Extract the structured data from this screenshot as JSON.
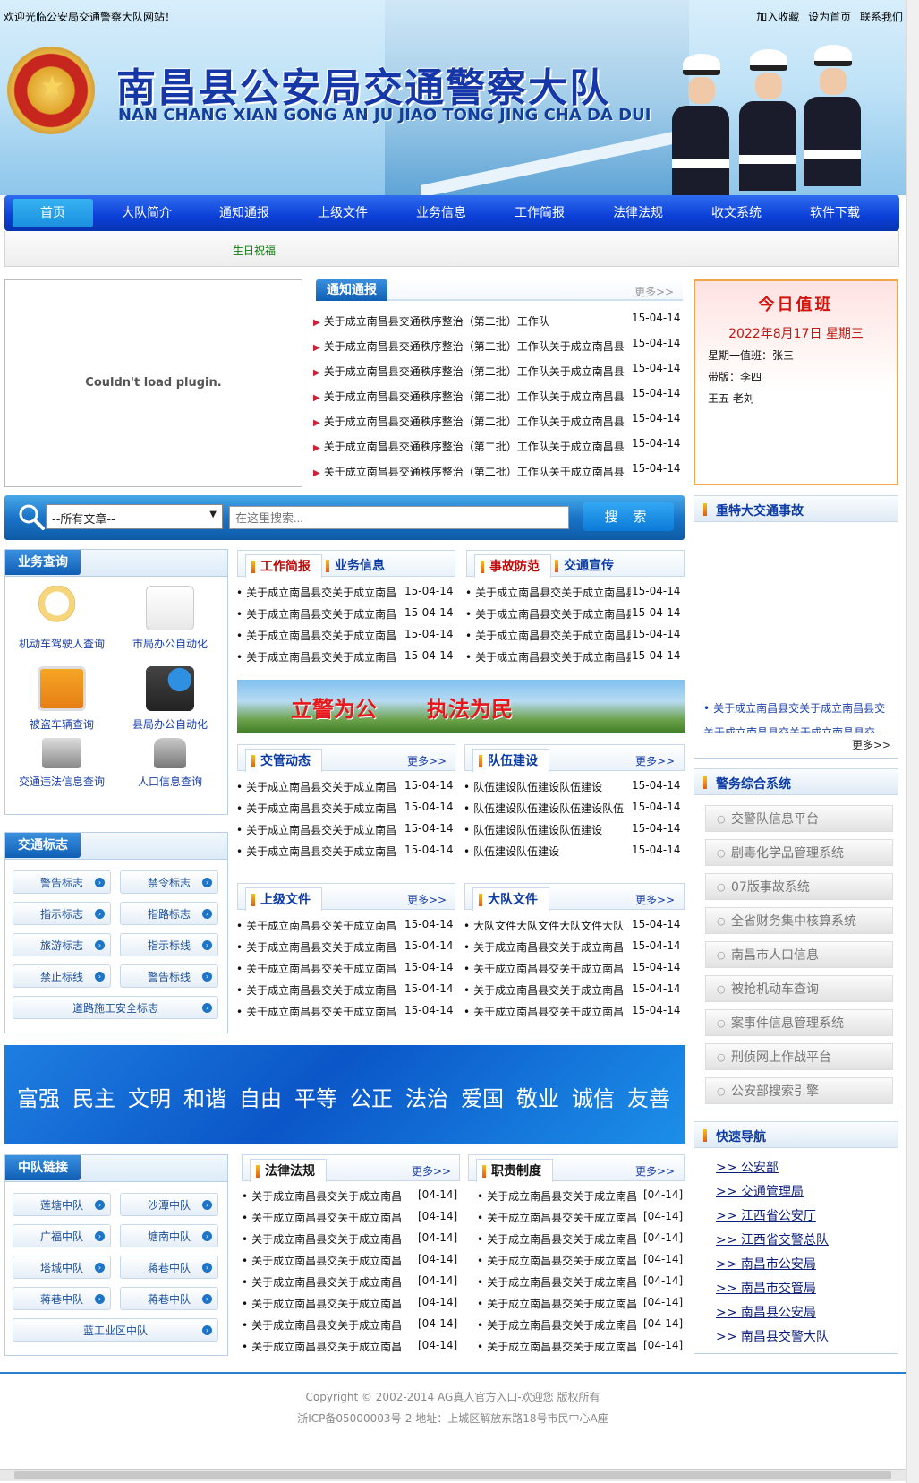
{
  "header": {
    "welcome": "欢迎光临公安局交通警察大队网站！",
    "links": [
      "加入收藏",
      "设为首页",
      "联系我们"
    ],
    "title_cn": "南昌县公安局交通警察大队",
    "title_en": "NAN CHANG XIAN GONG AN JU JIAO TONG JING CHA DA DUI"
  },
  "nav": {
    "items": [
      "首页",
      "大队简介",
      "通知通报",
      "上级文件",
      "业务信息",
      "工作简报",
      "法律法规",
      "收文系统",
      "软件下载"
    ],
    "active": "首页",
    "sub": "生日祝福"
  },
  "plugin": {
    "message": "Couldn't load plugin."
  },
  "notice": {
    "tab": "通知通报",
    "more": "更多>>",
    "items": [
      {
        "title": "关于成立南昌县交通秩序整治（第二批）工作队",
        "date": "15-04-14"
      },
      {
        "title": "关于成立南昌县交通秩序整治（第二批）工作队关于成立南昌县",
        "date": "15-04-14"
      },
      {
        "title": "关于成立南昌县交通秩序整治（第二批）工作队关于成立南昌县",
        "date": "15-04-14"
      },
      {
        "title": "关于成立南昌县交通秩序整治（第二批）工作队关于成立南昌县",
        "date": "15-04-14"
      },
      {
        "title": "关于成立南昌县交通秩序整治（第二批）工作队关于成立南昌县",
        "date": "15-04-14"
      },
      {
        "title": "关于成立南昌县交通秩序整治（第二批）工作队关于成立南昌县",
        "date": "15-04-14"
      },
      {
        "title": "关于成立南昌县交通秩序整治（第二批）工作队关于成立南昌县",
        "date": "15-04-14"
      }
    ]
  },
  "duty": {
    "title": "今日值班",
    "date": "2022年8月17日  星期三",
    "lines": [
      "星期一值班：张三",
      "带版：李四",
      "王五 老刘"
    ]
  },
  "search": {
    "select": "--所有文章--",
    "placeholder": "在这里搜索...",
    "button": "搜 索"
  },
  "business": {
    "title": "业务查询",
    "items": [
      "机动车驾驶人查询",
      "市局办公自动化",
      "被盗车辆查询",
      "县局办公自动化",
      "交通违法信息查询",
      "人口信息查询"
    ]
  },
  "signs": {
    "title": "交通标志",
    "items": [
      "警告标志",
      "禁令标志",
      "指示标志",
      "指路标志",
      "旅游标志",
      "指示标线",
      "禁止标线",
      "警告标线",
      "道路施工安全标志"
    ]
  },
  "squads": {
    "title": "中队链接",
    "items": [
      "莲塘中队",
      "沙潭中队",
      "广福中队",
      "塘南中队",
      "塔城中队",
      "蒋巷中队",
      "蒋巷中队",
      "蒋巷中队",
      "蓝工业区中队"
    ]
  },
  "box_work": {
    "tab1": "工作简报",
    "tab2": "业务信息",
    "rows": [
      {
        "title": "关于成立南昌县交关于成立南昌",
        "date": "15-04-14"
      },
      {
        "title": "关于成立南昌县交关于成立南昌",
        "date": "15-04-14"
      },
      {
        "title": "关于成立南昌县交关于成立南昌",
        "date": "15-04-14"
      },
      {
        "title": "关于成立南昌县交关于成立南昌",
        "date": "15-04-14"
      }
    ]
  },
  "box_accident": {
    "tab1": "事故防范",
    "tab2": "交通宣传",
    "rows": [
      {
        "title": "关于成立南昌县交关于成立南昌县",
        "date": "15-04-14"
      },
      {
        "title": "关于成立南昌县交关于成立南昌县",
        "date": "15-04-14"
      },
      {
        "title": "关于成立南昌县交关于成立南昌县",
        "date": "15-04-14"
      },
      {
        "title": "关于成立南昌县交关于成立南昌县",
        "date": "15-04-14"
      }
    ]
  },
  "banner1": {
    "left": "立警为公",
    "right": "执法为民"
  },
  "box_traffic": {
    "tab": "交管动态",
    "more": "更多>>",
    "rows": [
      {
        "title": "关于成立南昌县交关于成立南昌",
        "date": "15-04-14"
      },
      {
        "title": "关于成立南昌县交关于成立南昌",
        "date": "15-04-14"
      },
      {
        "title": "关于成立南昌县交关于成立南昌",
        "date": "15-04-14"
      },
      {
        "title": "关于成立南昌县交关于成立南昌",
        "date": "15-04-14"
      }
    ]
  },
  "box_team": {
    "tab": "队伍建设",
    "more": "更多>>",
    "rows": [
      {
        "title": "队伍建设队伍建设队伍建设",
        "date": "15-04-14"
      },
      {
        "title": "队伍建设队伍建设队伍建设队伍",
        "date": "15-04-14"
      },
      {
        "title": "队伍建设队伍建设队伍建设",
        "date": "15-04-14"
      },
      {
        "title": "队伍建设队伍建设",
        "date": "15-04-14"
      }
    ]
  },
  "box_superior": {
    "tab": "上级文件",
    "more": "更多>>",
    "rows": [
      {
        "title": "关于成立南昌县交关于成立南昌",
        "date": "15-04-14"
      },
      {
        "title": "关于成立南昌县交关于成立南昌",
        "date": "15-04-14"
      },
      {
        "title": "关于成立南昌县交关于成立南昌",
        "date": "15-04-14"
      },
      {
        "title": "关于成立南昌县交关于成立南昌",
        "date": "15-04-14"
      },
      {
        "title": "关于成立南昌县交关于成立南昌",
        "date": "15-04-14"
      }
    ]
  },
  "box_brigade": {
    "tab": "大队文件",
    "more": "更多>>",
    "rows": [
      {
        "title": "大队文件大队文件大队文件大队",
        "date": "15-04-14"
      },
      {
        "title": "关于成立南昌县交关于成立南昌",
        "date": "15-04-14"
      },
      {
        "title": "关于成立南昌县交关于成立南昌",
        "date": "15-04-14"
      },
      {
        "title": "关于成立南昌县交关于成立南昌",
        "date": "15-04-14"
      },
      {
        "title": "关于成立南昌县交关于成立南昌",
        "date": "15-04-14"
      }
    ]
  },
  "banner2": {
    "words": [
      "富强",
      "民主",
      "文明",
      "和谐",
      "自由",
      "平等",
      "公正",
      "法治",
      "爱国",
      "敬业",
      "诚信",
      "友善"
    ]
  },
  "box_law": {
    "tab": "法律法规",
    "more": "更多>>",
    "rows": [
      {
        "title": "关于成立南昌县交关于成立南昌",
        "date": "[04-14]"
      },
      {
        "title": "关于成立南昌县交关于成立南昌",
        "date": "[04-14]"
      },
      {
        "title": "关于成立南昌县交关于成立南昌",
        "date": "[04-14]"
      },
      {
        "title": "关于成立南昌县交关于成立南昌",
        "date": "[04-14]"
      },
      {
        "title": "关于成立南昌县交关于成立南昌",
        "date": "[04-14]"
      },
      {
        "title": "关于成立南昌县交关于成立南昌",
        "date": "[04-14]"
      },
      {
        "title": "关于成立南昌县交关于成立南昌",
        "date": "[04-14]"
      },
      {
        "title": "关于成立南昌县交关于成立南昌",
        "date": "[04-14]"
      }
    ]
  },
  "box_duty": {
    "tab": "职责制度",
    "more": "更多>>",
    "rows": [
      {
        "title": "关于成立南昌县交关于成立南昌",
        "date": "[04-14]"
      },
      {
        "title": "关于成立南昌县交关于成立南昌",
        "date": "[04-14]"
      },
      {
        "title": "关于成立南昌县交关于成立南昌",
        "date": "[04-14]"
      },
      {
        "title": "关于成立南昌县交关于成立南昌",
        "date": "[04-14]"
      },
      {
        "title": "关于成立南昌县交关于成立南昌",
        "date": "[04-14]"
      },
      {
        "title": "关于成立南昌县交关于成立南昌",
        "date": "[04-14]"
      },
      {
        "title": "关于成立南昌县交关于成立南昌",
        "date": "[04-14]"
      },
      {
        "title": "关于成立南昌县交关于成立南昌",
        "date": "[04-14]"
      }
    ]
  },
  "accident": {
    "title": "重特大交通事故",
    "items": [
      "关于成立南昌县交关于成立南昌县交",
      "关于成立南昌县交关于成立南昌县交"
    ],
    "more": "更多>>"
  },
  "systems": {
    "title": "警务综合系统",
    "items": [
      "交警队信息平台",
      "剧毒化学品管理系统",
      "07版事故系统",
      "全省财务集中核算系统",
      "南昌市人口信息",
      "被抢机动车查询",
      "案事件信息管理系统",
      "刑侦网上作战平台",
      "公安部搜索引擎"
    ]
  },
  "quicknav": {
    "title": "快速导航",
    "items": [
      ">> 公安部",
      ">> 交通管理局",
      ">> 江西省公安厅",
      ">> 江西省交警总队",
      ">> 南昌市公安局",
      ">> 南昌市交管局",
      ">> 南昌县公安局",
      ">> 南昌县交警大队"
    ]
  },
  "footer": {
    "copyright": "Copyright © 2002-2014 AG真人官方入口-欢迎您 版权所有",
    "icp": "浙ICP备05000003号-2 地址：上城区解放东路18号市民中心A座"
  }
}
